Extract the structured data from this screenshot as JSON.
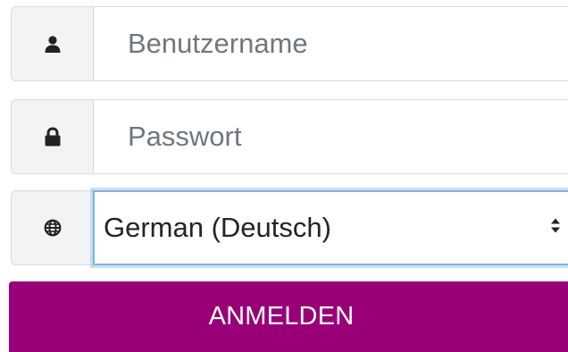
{
  "login_form": {
    "username": {
      "icon": "user-icon",
      "placeholder": "Benutzername",
      "value": ""
    },
    "password": {
      "icon": "lock-icon",
      "placeholder": "Passwort",
      "value": ""
    },
    "language": {
      "icon": "globe-icon",
      "selected": "German (Deutsch)"
    },
    "submit_label": "ANMELDEN"
  },
  "colors": {
    "button_bg": "#990077",
    "button_text": "#ffffff",
    "addon_bg": "#f1f3f5",
    "focus_border": "#80b3d9"
  }
}
